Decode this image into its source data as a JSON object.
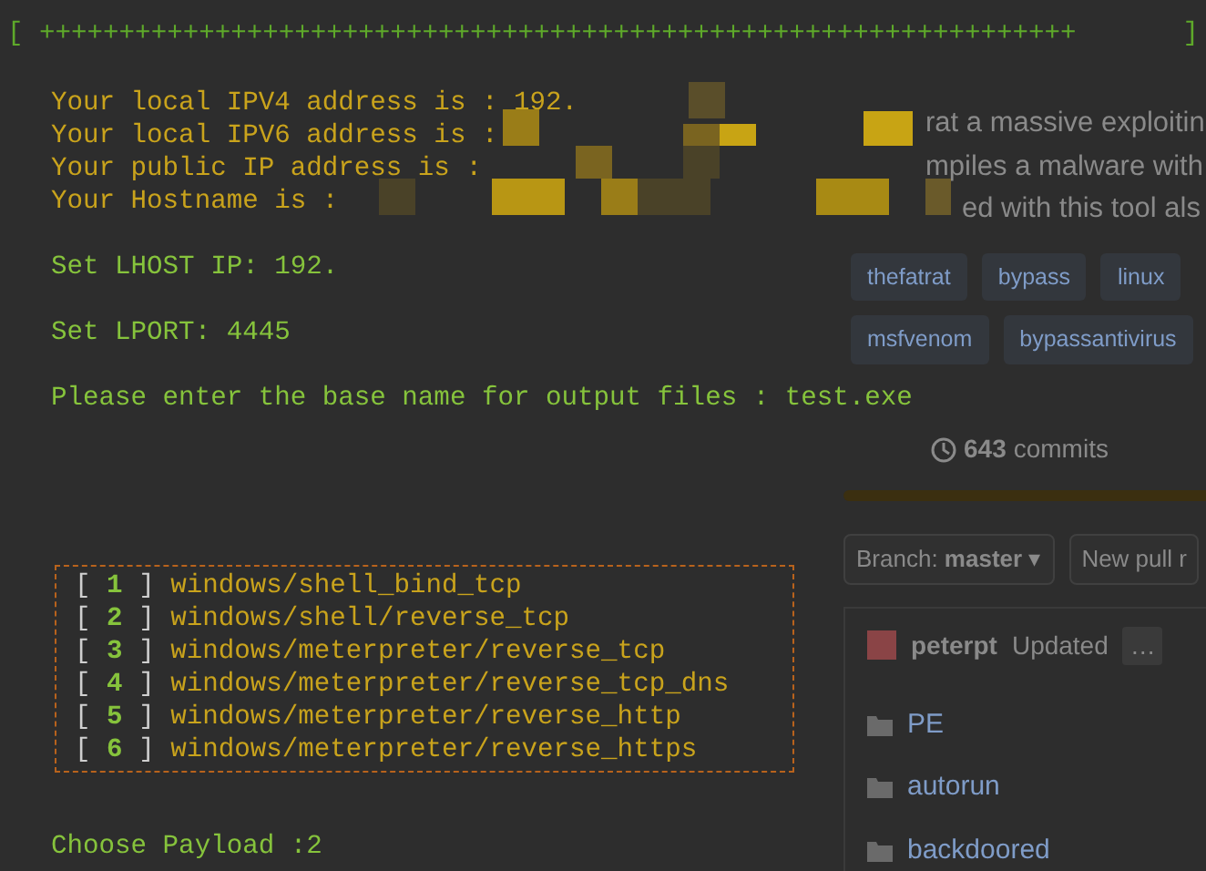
{
  "terminal": {
    "header": {
      "open": "[ +++++++++++++++++++++++++++++++++++++++++++++++++++++++++++++++++",
      "close": "]"
    },
    "info_lines": [
      "Your local IPV4 address is : 192.",
      "Your local IPV6 address is :",
      "Your public IP address is :",
      "Your Hostname is :"
    ],
    "lhost": "Set LHOST IP: 192.",
    "lport": "Set LPORT: 4445",
    "prompt": {
      "label": "Please enter the base name for output files :",
      "value": "test.exe"
    },
    "payloads": [
      {
        "bracket_open": "[",
        "number": "1",
        "bracket_close": "]",
        "name": "windows/shell_bind_tcp"
      },
      {
        "bracket_open": "[",
        "number": "2",
        "bracket_close": "]",
        "name": "windows/shell/reverse_tcp"
      },
      {
        "bracket_open": "[",
        "number": "3",
        "bracket_close": "]",
        "name": "windows/meterpreter/reverse_tcp"
      },
      {
        "bracket_open": "[",
        "number": "4",
        "bracket_close": "]",
        "name": "windows/meterpreter/reverse_tcp_dns"
      },
      {
        "bracket_open": "[",
        "number": "5",
        "bracket_close": "]",
        "name": "windows/meterpreter/reverse_http"
      },
      {
        "bracket_open": "[",
        "number": "6",
        "bracket_close": "]",
        "name": "windows/meterpreter/reverse_https"
      }
    ],
    "choose": "Choose Payload :2"
  },
  "background_page": {
    "description": [
      "rat a massive exploitin",
      "mpiles a malware with",
      "ed with this tool als"
    ],
    "topics": [
      [
        "thefatrat",
        "bypass",
        "linux"
      ],
      [
        "msfvenom",
        "bypassantivirus"
      ]
    ],
    "commits": {
      "count": "643",
      "label": "commits"
    },
    "branch": {
      "label": "Branch:",
      "value": "master",
      "caret": "▾"
    },
    "new_pull": "New pull r",
    "commit": {
      "author": "peterpt",
      "message": "Updated",
      "more": "…"
    },
    "files": [
      "PE",
      "autorun",
      "backdoored"
    ]
  }
}
